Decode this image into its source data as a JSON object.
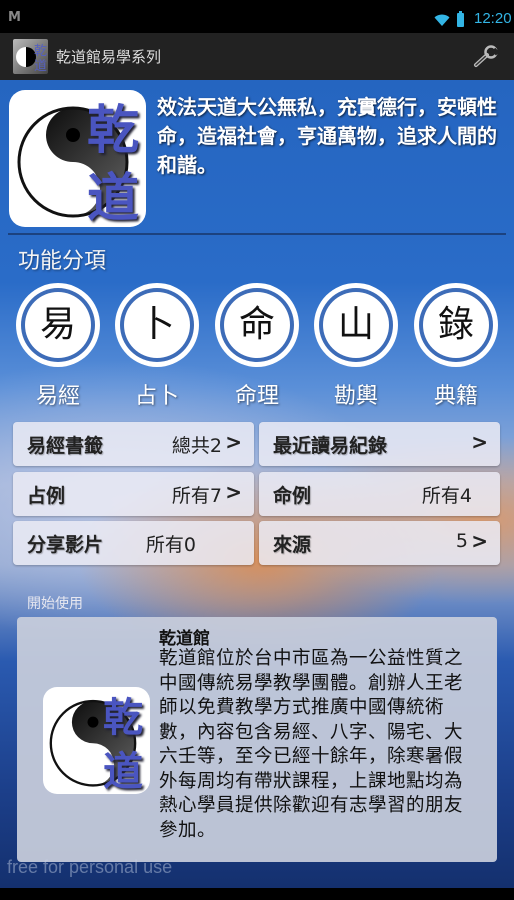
{
  "status_bar": {
    "notification_icon": "gmail-icon",
    "time": "12:20",
    "wifi_icon": "wifi-icon",
    "battery_icon": "battery-icon",
    "accent_color": "#33b5e5"
  },
  "action_bar": {
    "title": "乾道館易學系列",
    "app_icon_chars": [
      "乾",
      "道"
    ],
    "settings_icon": "wrench-icon"
  },
  "header": {
    "logo_chars": [
      "乾",
      "道"
    ],
    "motto": "效法天道大公無私，充實德行，安頓性命，造福社會，亨通萬物，追求人間的和諧。"
  },
  "functions": {
    "title": "功能分項",
    "items": [
      {
        "glyph": "易",
        "label": "易經"
      },
      {
        "glyph": "卜",
        "label": "占卜"
      },
      {
        "glyph": "命",
        "label": "命理"
      },
      {
        "glyph": "山",
        "label": "勘輿"
      },
      {
        "glyph": "錄",
        "label": "典籍"
      }
    ]
  },
  "grid": [
    {
      "label": "易經書籤",
      "value": "總共2",
      "chevron": true
    },
    {
      "label": "最近讀易紀錄",
      "value": "",
      "chevron": true
    },
    {
      "label": "占例",
      "value": "所有7",
      "chevron": true
    },
    {
      "label": "命例",
      "value": "所有4",
      "chevron": false
    },
    {
      "label": "分享影片",
      "value": "所有0",
      "chevron": false
    },
    {
      "label": "來源",
      "value": "5",
      "chevron": true
    }
  ],
  "start": {
    "label": "開始使用",
    "card": {
      "logo_chars": [
        "乾",
        "道"
      ],
      "title": "乾道館",
      "body": "乾道館位於台中市區為一公益性質之中國傳統易學教學團體。創辦人王老師以免費教學方式推廣中國傳統術數，內容包含易經、八字、陽宅、大六壬等，至今已經十餘年，除寒暑假外每周均有帶狀課程，上課地點均為熱心學員提供除歡迎有志學習的朋友參加。"
    }
  },
  "watermark": "free for personal use"
}
